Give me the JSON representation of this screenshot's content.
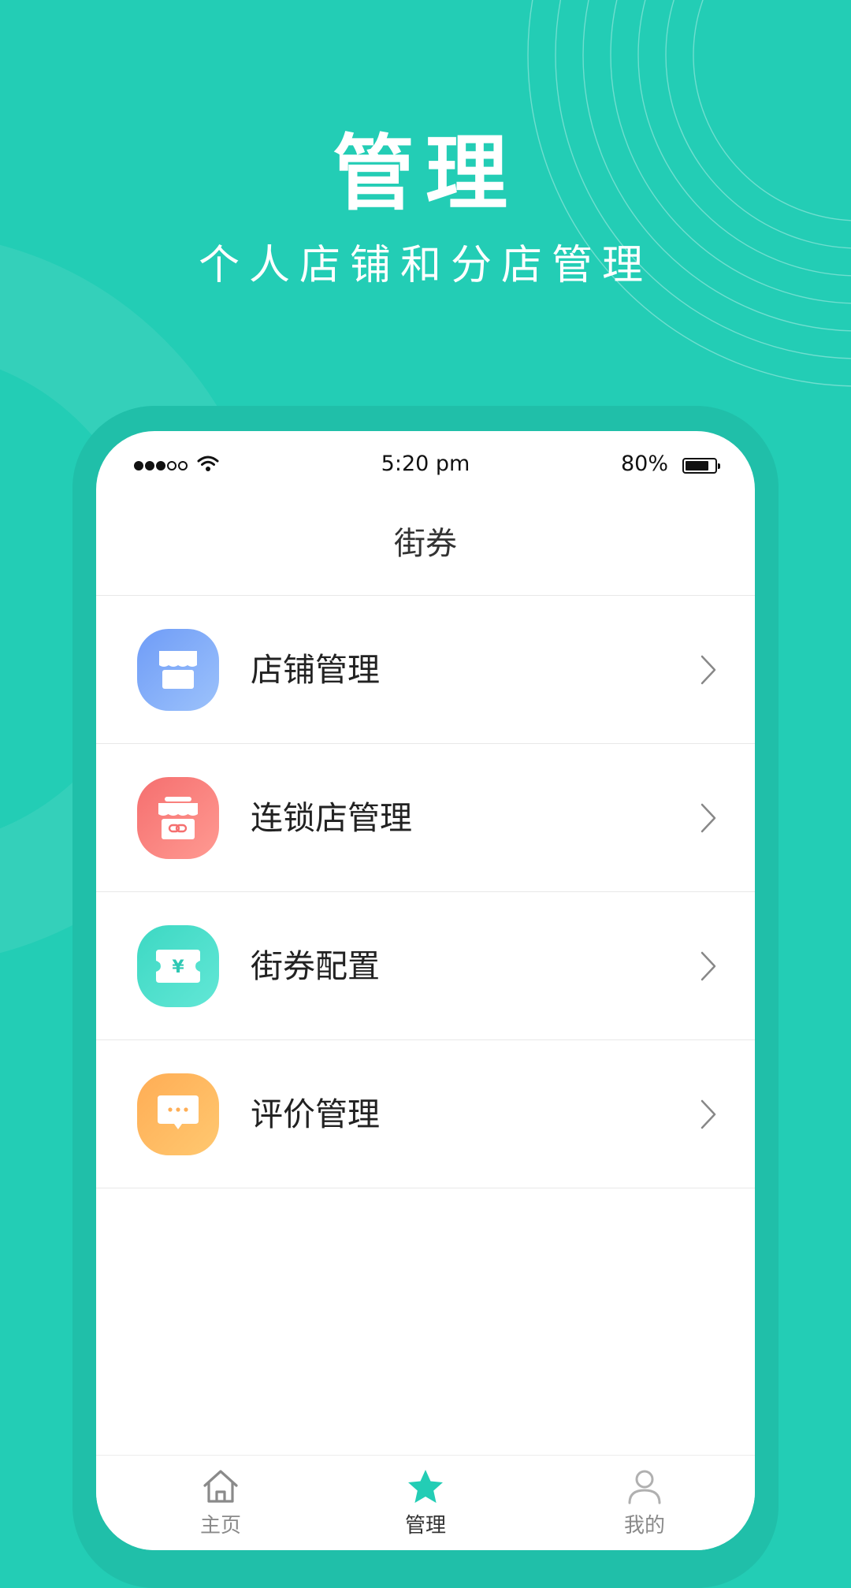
{
  "promo": {
    "title": "管理",
    "subtitle": "个人店铺和分店管理"
  },
  "colors": {
    "background": "#23cdb5",
    "phone_frame": "#20bfa9",
    "accent": "#23cdb5"
  },
  "status_bar": {
    "time": "5:20 pm",
    "battery": "80%",
    "battery_level": 0.8,
    "signal_bars": 3,
    "signal_total": 5
  },
  "nav": {
    "title": "街券"
  },
  "menu": {
    "items": [
      {
        "label": "店铺管理",
        "icon": "store-icon",
        "color_from": "#6f9cf7",
        "color_to": "#9cc2fb"
      },
      {
        "label": "连锁店管理",
        "icon": "chain-store-icon",
        "color_from": "#f56f6f",
        "color_to": "#ff9a92"
      },
      {
        "label": "街券配置",
        "icon": "coupon-icon",
        "color_from": "#3dd8c3",
        "color_to": "#62e7d6"
      },
      {
        "label": "评价管理",
        "icon": "comment-icon",
        "color_from": "#ffad55",
        "color_to": "#ffc870"
      }
    ]
  },
  "tab_bar": {
    "tabs": [
      {
        "label": "主页",
        "icon": "home-icon",
        "active": false
      },
      {
        "label": "管理",
        "icon": "star-icon",
        "active": true
      },
      {
        "label": "我的",
        "icon": "user-icon",
        "active": false
      }
    ]
  }
}
